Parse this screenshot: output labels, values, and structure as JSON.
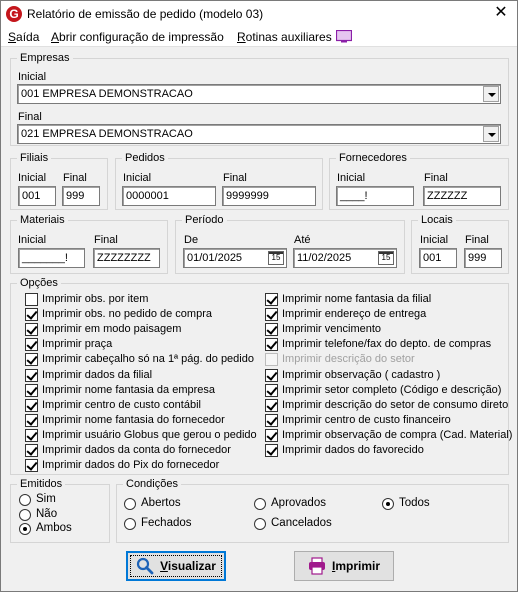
{
  "window": {
    "title": "Relatório de emissão de pedido (modelo 03)"
  },
  "menu": {
    "saida": {
      "accel": "S",
      "rest": "aída"
    },
    "abrir": {
      "accel": "A",
      "rest": "brir configuração de impressão"
    },
    "rotinas": {
      "accel": "R",
      "rest": "otinas auxiliares"
    }
  },
  "empresas": {
    "legend": "Empresas",
    "inicial_label": "Inicial",
    "inicial_value": "001 EMPRESA DEMONSTRACAO",
    "final_label": "Final",
    "final_value": "021 EMPRESA DEMONSTRACAO"
  },
  "filiais": {
    "legend": "Filiais",
    "inicial_label": "Inicial",
    "inicial_value": "001",
    "final_label": "Final",
    "final_value": "999"
  },
  "pedidos": {
    "legend": "Pedidos",
    "inicial_label": "Inicial",
    "inicial_value": "0000001",
    "final_label": "Final",
    "final_value": "9999999"
  },
  "fornecedores": {
    "legend": "Fornecedores",
    "inicial_label": "Inicial",
    "inicial_value": "____!",
    "final_label": "Final",
    "final_value": "ZZZZZZ"
  },
  "materiais": {
    "legend": "Materiais",
    "inicial_label": "Inicial",
    "inicial_value": "_______!",
    "final_label": "Final",
    "final_value": "ZZZZZZZZ"
  },
  "periodo": {
    "legend": "Período",
    "de_label": "De",
    "de_value": "01/01/2025",
    "ate_label": "Até",
    "ate_value": "11/02/2025",
    "cal_label": "15"
  },
  "locais": {
    "legend": "Locais",
    "inicial_label": "Inicial",
    "inicial_value": "001",
    "final_label": "Final",
    "final_value": "999"
  },
  "opcoes": {
    "legend": "Opções",
    "left": [
      {
        "label": "Imprimir obs. por item",
        "checked": false,
        "enabled": true
      },
      {
        "label": "Imprimir obs. no pedido de compra",
        "checked": true,
        "enabled": true
      },
      {
        "label": "Imprimir em modo paisagem",
        "checked": true,
        "enabled": true
      },
      {
        "label": "Imprimir praça",
        "checked": true,
        "enabled": true
      },
      {
        "label": "Imprimir cabeçalho só na 1ª pág. do pedido",
        "checked": true,
        "enabled": true
      },
      {
        "label": "Imprimir dados da filial",
        "checked": true,
        "enabled": true
      },
      {
        "label": "Imprimir nome fantasia da empresa",
        "checked": true,
        "enabled": true
      },
      {
        "label": "Imprimir centro de custo contábil",
        "checked": true,
        "enabled": true
      },
      {
        "label": "Imprimir nome fantasia do fornecedor",
        "checked": true,
        "enabled": true
      },
      {
        "label": "Imprimir usuário Globus que gerou o pedido",
        "checked": true,
        "enabled": true
      },
      {
        "label": "Imprimir dados da conta do fornecedor",
        "checked": true,
        "enabled": true
      },
      {
        "label": "Imprimir dados do Pix do fornecedor",
        "checked": true,
        "enabled": true
      }
    ],
    "right": [
      {
        "label": "Imprimir nome fantasia da filial",
        "checked": true,
        "enabled": true
      },
      {
        "label": "Imprimir endereço de entrega",
        "checked": true,
        "enabled": true
      },
      {
        "label": "Imprimir vencimento",
        "checked": true,
        "enabled": true
      },
      {
        "label": "Imprimir telefone/fax do depto. de compras",
        "checked": true,
        "enabled": true
      },
      {
        "label": "Imprimir descrição do setor",
        "checked": false,
        "enabled": false
      },
      {
        "label": "Imprimir observação ( cadastro )",
        "checked": true,
        "enabled": true
      },
      {
        "label": "Imprimir setor completo (Código e descrição)",
        "checked": true,
        "enabled": true
      },
      {
        "label": "Imprimir descrição do setor de consumo direto",
        "checked": true,
        "enabled": true
      },
      {
        "label": "Imprimir centro de custo financeiro",
        "checked": true,
        "enabled": true
      },
      {
        "label": "Imprimir observação de compra (Cad. Material)",
        "checked": true,
        "enabled": true
      },
      {
        "label": "Imprimir dados do favorecido",
        "checked": true,
        "enabled": true
      }
    ]
  },
  "emitidos": {
    "legend": "Emitidos",
    "options": [
      {
        "label": "Sim",
        "selected": false
      },
      {
        "label": "Não",
        "selected": false
      },
      {
        "label": "Ambos",
        "selected": true
      }
    ]
  },
  "condicoes": {
    "legend": "Condições",
    "options": [
      {
        "label": "Abertos",
        "selected": false
      },
      {
        "label": "Aprovados",
        "selected": false
      },
      {
        "label": "Todos",
        "selected": true
      },
      {
        "label": "Fechados",
        "selected": false
      },
      {
        "label": "Cancelados",
        "selected": false
      }
    ]
  },
  "buttons": {
    "visualizar": {
      "accel": "V",
      "rest": "isualizar"
    },
    "imprimir": {
      "accel": "I",
      "rest": "mprimir"
    }
  },
  "colors": {
    "accent": "#0078d7",
    "print_icon": "#a0198c",
    "magnifier": "#1e63b8",
    "app_icon": "#c4161c"
  }
}
